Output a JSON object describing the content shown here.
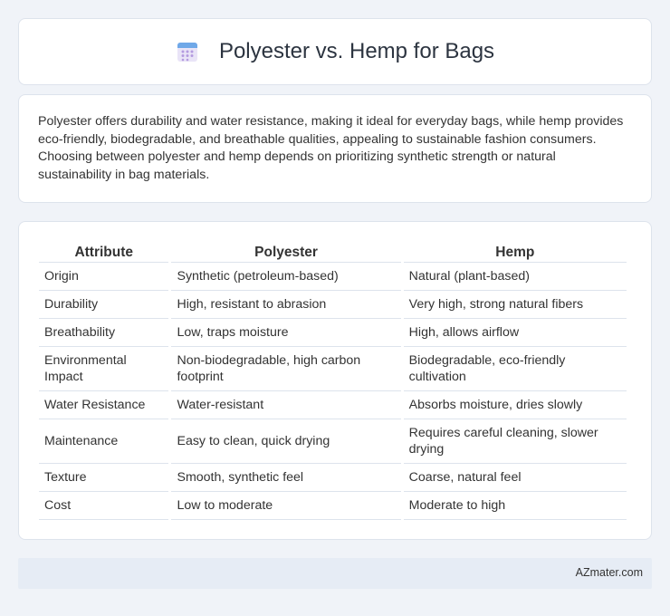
{
  "header": {
    "title": "Polyester vs. Hemp for Bags",
    "icon": "calendar-icon",
    "icon_colors": {
      "top": "#6fa8e8",
      "body": "#e9e4f7",
      "dots": "#b49be0"
    }
  },
  "intro": {
    "text": "Polyester offers durability and water resistance, making it ideal for everyday bags, while hemp provides eco-friendly, biodegradable, and breathable qualities, appealing to sustainable fashion consumers. Choosing between polyester and hemp depends on prioritizing synthetic strength or natural sustainability in bag materials."
  },
  "table": {
    "headers": [
      "Attribute",
      "Polyester",
      "Hemp"
    ],
    "rows": [
      [
        "Origin",
        "Synthetic (petroleum-based)",
        "Natural (plant-based)"
      ],
      [
        "Durability",
        "High, resistant to abrasion",
        "Very high, strong natural fibers"
      ],
      [
        "Breathability",
        "Low, traps moisture",
        "High, allows airflow"
      ],
      [
        "Environmental Impact",
        "Non-biodegradable, high carbon footprint",
        "Biodegradable, eco-friendly cultivation"
      ],
      [
        "Water Resistance",
        "Water-resistant",
        "Absorbs moisture, dries slowly"
      ],
      [
        "Maintenance",
        "Easy to clean, quick drying",
        "Requires careful cleaning, slower drying"
      ],
      [
        "Texture",
        "Smooth, synthetic feel",
        "Coarse, natural feel"
      ],
      [
        "Cost",
        "Low to moderate",
        "Moderate to high"
      ]
    ]
  },
  "footer": {
    "text": "AZmater.com"
  },
  "colors": {
    "background": "#f0f3f8",
    "card": "#ffffff",
    "border": "#dde3ec",
    "footer": "#e6ecf5"
  }
}
